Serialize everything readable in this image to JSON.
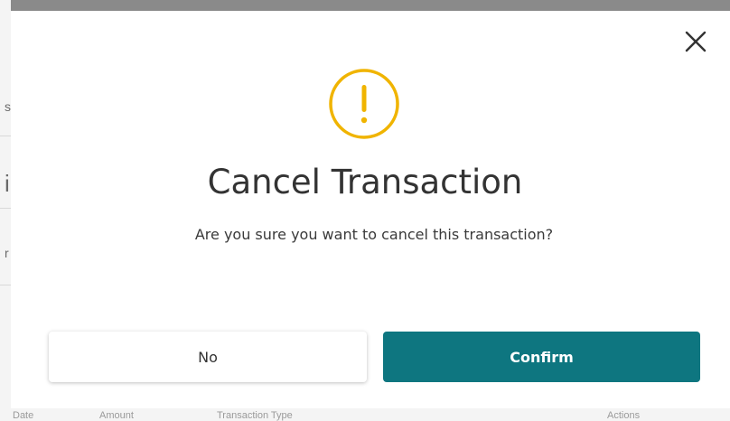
{
  "dialog": {
    "title": "Cancel Transaction",
    "message": "Are you sure you want to cancel this transaction?",
    "no_label": "No",
    "confirm_label": "Confirm",
    "close_icon": "close-icon",
    "warning_icon": "exclamation-circle-icon"
  },
  "background": {
    "sliver_glyphs": [
      "s",
      "i",
      "r"
    ],
    "footer_fragments": [
      "Date",
      "Amount",
      "Transaction Type",
      "Actions"
    ]
  },
  "colors": {
    "accent": "#0e7680",
    "warning": "#f0b400",
    "backdrop": "#8a8a8a"
  }
}
